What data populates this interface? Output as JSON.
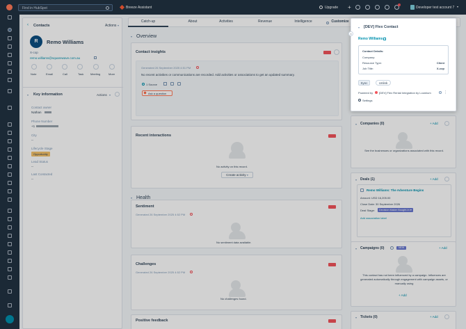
{
  "app": {
    "search_placeholder": "Find in HubSpot",
    "breeze": "Breeze Assistant",
    "upgrade": "Upgrade",
    "account": "Developer test account 7"
  },
  "left": {
    "back": "Contacts",
    "actions": "Actions",
    "name": "Remo Williams",
    "subtitle": "X-cop",
    "email": "remo.williams@squarewave.com.au",
    "actions_row": [
      "Note",
      "Email",
      "Call",
      "Task",
      "Meeting",
      "More"
    ],
    "key_title": "Key information",
    "key_actions": "Actions",
    "fields": [
      {
        "label": "Contact owner",
        "value": "Nathan"
      },
      {
        "label": "Phone Number",
        "value": "+1"
      },
      {
        "label": "City",
        "value": "--"
      },
      {
        "label": "Lifecycle Stage",
        "value": "Opportunity"
      },
      {
        "label": "Lead Status",
        "value": "--"
      },
      {
        "label": "Last Contacted",
        "value": "--"
      }
    ]
  },
  "tabs": [
    "Catch-up",
    "About",
    "Activities",
    "Revenue",
    "Intelligence",
    "Customize"
  ],
  "center": {
    "overview": "Overview",
    "insights_title": "Contact insights",
    "insights_date": "Generated 26 September 2025 4:51 PM",
    "insights_text": "No recent activities or communications are recorded. Add activities or associations to get an updated summary.",
    "source": "1 Source",
    "ask": "Ask a question",
    "recent_title": "Recent interactions",
    "recent_empty": "No activity on this record.",
    "create_activity": "Create activity",
    "health": "Health",
    "sentiment_title": "Sentiment",
    "sentiment_date": "Generated 26 September 2025 4:52 PM",
    "sentiment_empty": "No sentiment data available.",
    "challenges_title": "Challenges",
    "challenges_date": "Generated 26 September 2025 4:52 PM",
    "challenges_empty": "No challenges found.",
    "positive_title": "Positive feedback"
  },
  "popup": {
    "title": "[DEV] Flex Contact",
    "contact_link": "Remo Williams",
    "details_title": "Contact Details:",
    "company_label": "Company:",
    "company_value": "",
    "resource_label": "Resource Type:",
    "resource_value": "Client",
    "job_label": "Job Title:",
    "job_value": "X-cop",
    "sync": "Sync",
    "unlink": "Unlink",
    "powered_prefix": "Powered by",
    "powered_text": "[DEV] Flex Rental Integration by Loomium",
    "settings": "Settings"
  },
  "right": {
    "companies_title": "Companies (0)",
    "add": "Add",
    "companies_text": "See the businesses or organizations associated with this record.",
    "deals_title": "Deals (1)",
    "deal_name": "Remo Williams: The Adventure Begins",
    "amount": "Amount: USD 16,205.00",
    "close": "Close Date: 30 September 2026",
    "stage_label": "Deal Stage:",
    "stage_value": "Decision Maker Bought-In",
    "add_assoc": "Add association label",
    "view_all": "View all associated Deals",
    "campaigns_title": "Campaigns (0)",
    "new_badge": "NEW",
    "campaigns_text": "This contact has not been influenced by a campaign. Influences are generated automatically through engagement with campaign assets, or manually using",
    "campaigns_add": "Add",
    "tickets_title": "Tickets (0)"
  }
}
